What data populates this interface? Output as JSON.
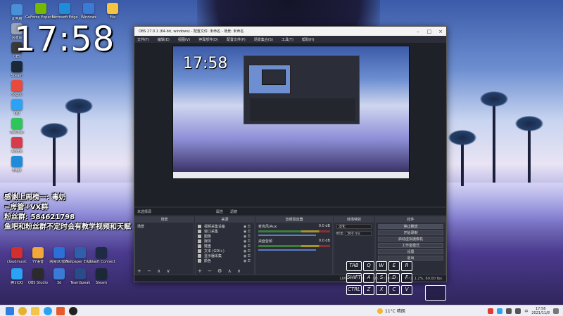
{
  "desktop": {
    "clock": "17:58",
    "icons_col1": [
      {
        "label": "此电脑",
        "color": "#4a90d9"
      },
      {
        "label": "回收站",
        "color": "#9aa4b8"
      },
      {
        "label": "OBS",
        "color": "#3a3a3a"
      },
      {
        "label": "Steam",
        "color": "#1b2838"
      },
      {
        "label": "Sogou",
        "color": "#e84a3c"
      },
      {
        "label": "QQ",
        "color": "#2aa3f4"
      },
      {
        "label": "WeChat",
        "color": "#2ec55a"
      },
      {
        "label": "Adobe",
        "color": "#d83b4b"
      },
      {
        "label": "Edge",
        "color": "#1f8cd9"
      }
    ],
    "icons_row_top": [
      {
        "label": "GeForce Experience",
        "color": "#76b900"
      },
      {
        "label": "Microsoft Edge",
        "color": "#1f8cd9"
      },
      {
        "label": "Windows",
        "color": "#3a7bd5"
      },
      {
        "label": "File",
        "color": "#f5c542"
      }
    ],
    "icons_bottom": [
      {
        "label": "cloudmusic",
        "color": "#d22f2f"
      },
      {
        "label": "YY语音",
        "color": "#f2a73b"
      },
      {
        "label": "网易UU加速",
        "color": "#2b6fd8"
      },
      {
        "label": "Wallpaper Engine",
        "color": "#2f5fa8"
      },
      {
        "label": "Ubisoft Connect",
        "color": "#1f2a44"
      },
      {
        "label": "腾讯QQ",
        "color": "#2aa3f4"
      },
      {
        "label": "OBS Studio",
        "color": "#2b2b2b"
      },
      {
        "label": "3d",
        "color": "#3a7bd5"
      },
      {
        "label": "TeamSpeak",
        "color": "#2b4a8a"
      },
      {
        "label": "Steam",
        "color": "#1b2838"
      }
    ]
  },
  "overlay": {
    "line1": "感谢上周榜一: 毒奶",
    "line2": "=房管+VX群",
    "line3": "粉丝群: 584621798",
    "line4": "鱼吧和粉丝群不定时会有教学视频和天赋"
  },
  "obs": {
    "title": "OBS 27.0.1 (64-bit, windows) - 配置文件: 未命名 - 场景: 未命名",
    "menu": [
      "文件(F)",
      "编辑(E)",
      "视图(V)",
      "停靠部件(D)",
      "配置文件(P)",
      "场景集合(S)",
      "工具(T)",
      "帮助(H)"
    ],
    "preview_clock": "17:58",
    "scene_bar_label": "未选择源",
    "scene_bar_buttons": [
      "属性",
      "滤镜"
    ],
    "docks": {
      "scenes": {
        "title": "场景",
        "items": [
          "场景"
        ]
      },
      "sources": {
        "title": "来源",
        "items": [
          "视频采集设备",
          "窗口采集",
          "图像",
          "媒体",
          "键盘",
          "文本 (GDI+)",
          "显示器采集",
          "颜色"
        ]
      },
      "mixer": {
        "title": "音频混音器",
        "rows": [
          {
            "name": "麦克风/Aux",
            "db": "0.0 dB"
          },
          {
            "name": "桌面音频",
            "db": "0.0 dB"
          }
        ]
      },
      "transitions": {
        "title": "转场特效",
        "type_label": "淡化",
        "duration_label": "时长",
        "duration_value": "300 ms"
      },
      "controls": {
        "title": "控件",
        "buttons": [
          "停止推流",
          "开始录制",
          "启动虚拟摄像机",
          "工作室模式",
          "设置",
          "退出"
        ]
      }
    },
    "status": {
      "live": "LIVE: 00:00:00",
      "rec": "REC: 00:00:00",
      "cpu": "CPU: 1.2%, 60.00 fps"
    }
  },
  "keyboard": {
    "row1": [
      "TAB",
      "Q",
      "W",
      "E",
      "R"
    ],
    "row2": [
      "SHIFT",
      "A",
      "S",
      "D",
      "F"
    ],
    "row3": [
      "CTRL",
      "Z",
      "X",
      "C",
      "V"
    ]
  },
  "taskbar": {
    "weather": "11°C 晴朗",
    "time": "17:58",
    "date": "2021/11/8",
    "lang": "中"
  }
}
